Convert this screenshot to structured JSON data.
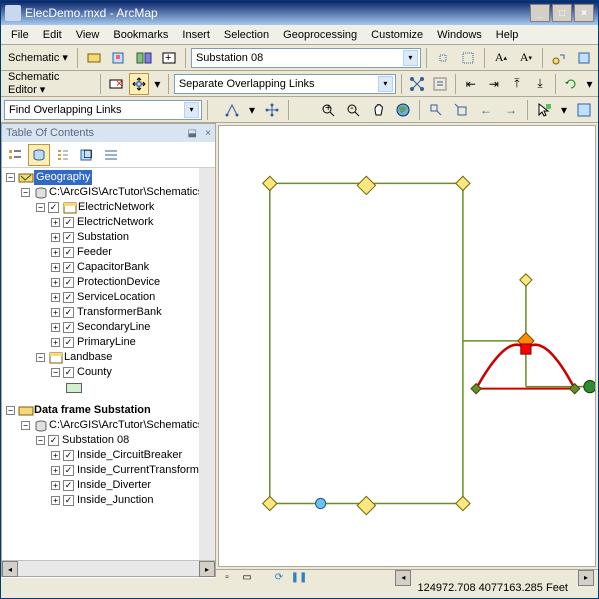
{
  "window": {
    "title": "ElecDemo.mxd - ArcMap"
  },
  "menu": [
    "File",
    "Edit",
    "View",
    "Bookmarks",
    "Insert",
    "Selection",
    "Geoprocessing",
    "Customize",
    "Windows",
    "Help"
  ],
  "toolbar1": {
    "schematic": "Schematic",
    "layer": "Substation 08"
  },
  "toolbar2": {
    "editor": "Schematic Editor",
    "layout": "Separate Overlapping Links"
  },
  "toolbar3": {
    "task": "Find Overlapping Links"
  },
  "toc": {
    "title": "Table Of Contents",
    "frame1": "Geography",
    "gdb1": "C:\\ArcGIS\\ArcTutor\\Schematics",
    "dataset1": "ElectricNetwork",
    "layers1": [
      "ElectricNetwork",
      "Substation",
      "Feeder",
      "CapacitorBank",
      "ProtectionDevice",
      "ServiceLocation",
      "TransformerBank",
      "SecondaryLine",
      "PrimaryLine"
    ],
    "landbase": "Landbase",
    "county": "County",
    "frame2": "Data frame Substation",
    "gdb2": "C:\\ArcGIS\\ArcTutor\\Schematics",
    "dataset2": "Substation 08",
    "layers2": [
      "Inside_CircuitBreaker",
      "Inside_CurrentTransformer",
      "Inside_Diverter",
      "Inside_Junction"
    ]
  },
  "status": {
    "coords": "124972.708  4077163.285 Feet"
  }
}
